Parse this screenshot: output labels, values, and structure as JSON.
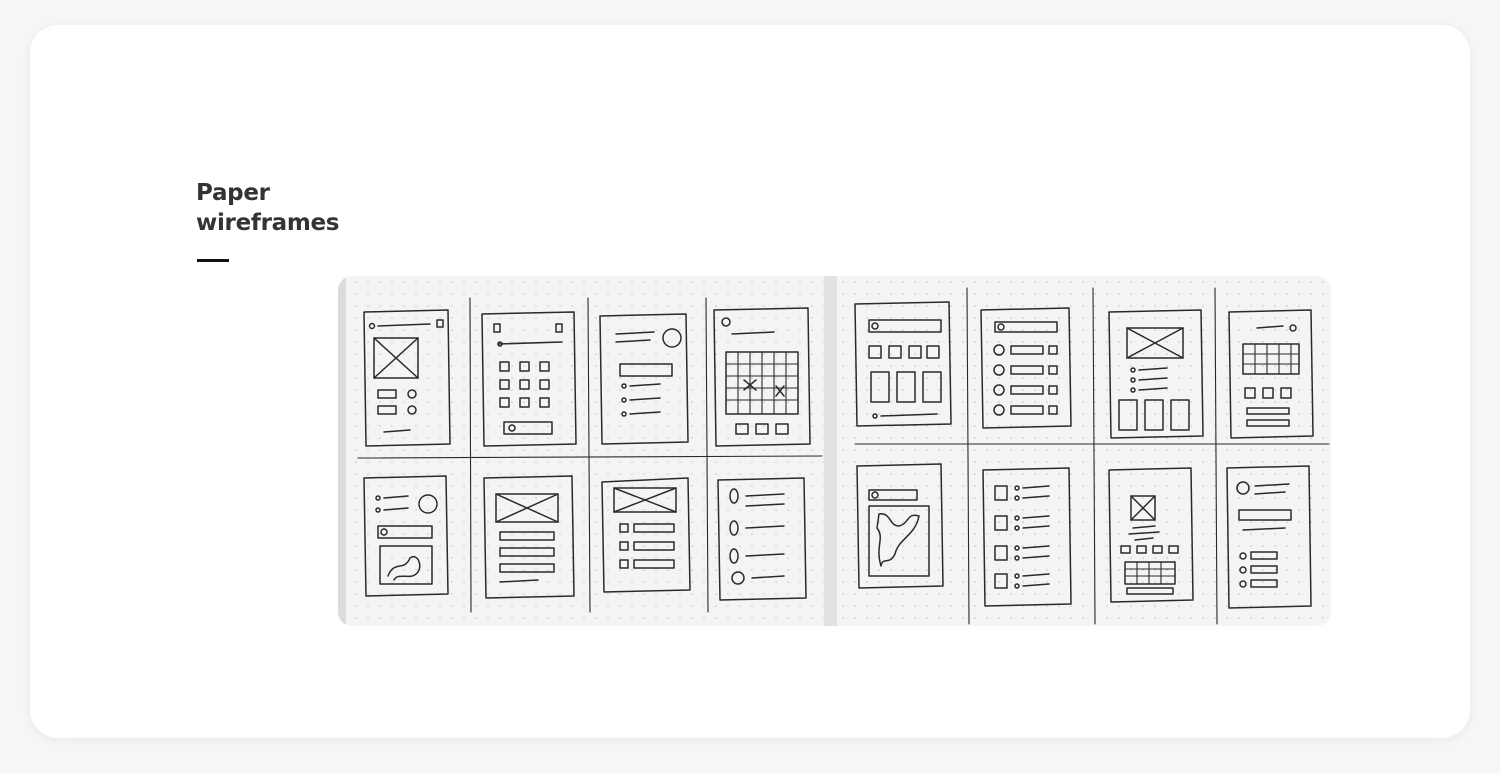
{
  "section": {
    "title": "Paper wireframes"
  },
  "images": [
    {
      "name": "paper-wireframes-sheet-1"
    },
    {
      "name": "paper-wireframes-sheet-2"
    }
  ]
}
